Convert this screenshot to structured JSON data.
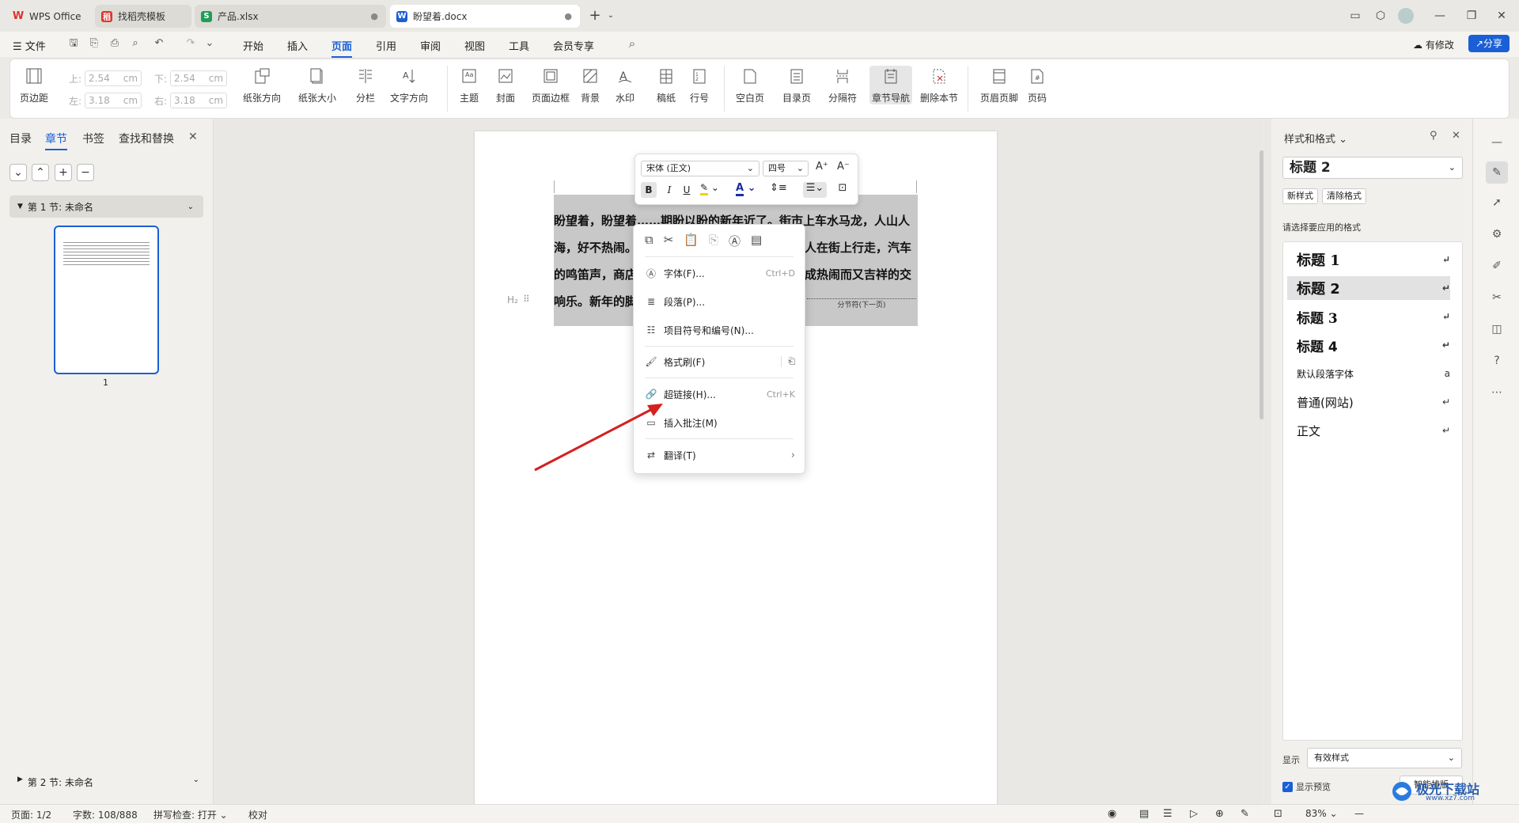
{
  "tabs": [
    {
      "label": "WPS Office",
      "icon": "wps-logo-icon",
      "color": "#e0312b"
    },
    {
      "label": "找稻壳模板",
      "icon": "docer-icon",
      "color": "#e0312b"
    },
    {
      "label": "产品.xlsx",
      "icon": "spreadsheet-icon",
      "color": "#1f9d55"
    },
    {
      "label": "盼望着.docx",
      "icon": "writer-icon",
      "color": "#1a5fd6"
    }
  ],
  "menu": {
    "file": "文件",
    "items": [
      "开始",
      "插入",
      "页面",
      "引用",
      "审阅",
      "视图",
      "工具",
      "会员专享"
    ],
    "active": "页面",
    "revise": "有修改",
    "share": "分享"
  },
  "ribbon": {
    "margins": {
      "top_label": "上:",
      "top_value": "2.54",
      "bottom_label": "下:",
      "bottom_value": "2.54",
      "left_label": "左:",
      "left_value": "3.18",
      "right_label": "右:",
      "right_value": "3.18",
      "unit": "cm"
    },
    "buttons": [
      "页边距",
      "纸张方向",
      "纸张大小",
      "分栏",
      "文字方向",
      "主题",
      "封面",
      "页面边框",
      "背景",
      "水印",
      "稿纸",
      "行号",
      "空白页",
      "目录页",
      "分隔符",
      "章节导航",
      "删除本节",
      "页眉页脚",
      "页码"
    ]
  },
  "left_panel": {
    "tabs": [
      "目录",
      "章节",
      "书签",
      "查找和替换"
    ],
    "active_tab": "章节",
    "section1": "第 1 节: 未命名",
    "section2": "第 2 节: 未命名",
    "page_num": "1"
  },
  "document": {
    "lines": [
      "盼望着，盼望着……期盼以盼的新年近了。街市上车水马龙，人山人",
      "海，好不热闹。",
      "的鸣笛声，商店",
      "响乐。新年的脚"
    ],
    "line2_right": "人在街上行走，汽车",
    "line3_right": "成热闹而又吉祥的交",
    "section_break": "分节符(下一页)",
    "heading_marker": "H₂"
  },
  "mini_toolbar": {
    "font": "宋体 (正文)",
    "size": "四号",
    "bold": "B",
    "italic": "I",
    "underline": "U"
  },
  "context_menu": [
    {
      "label": "字体(F)...",
      "shortcut": "Ctrl+D",
      "icon": "font-icon"
    },
    {
      "label": "段落(P)...",
      "shortcut": "",
      "icon": "paragraph-icon"
    },
    {
      "label": "项目符号和编号(N)...",
      "shortcut": "",
      "icon": "list-icon"
    },
    {
      "label": "格式刷(F)",
      "shortcut": "",
      "icon": "format-painter-icon"
    },
    {
      "label": "超链接(H)...",
      "shortcut": "Ctrl+K",
      "icon": "hyperlink-icon"
    },
    {
      "label": "插入批注(M)",
      "shortcut": "",
      "icon": "comment-icon"
    },
    {
      "label": "翻译(T)",
      "shortcut": "",
      "icon": "translate-icon"
    }
  ],
  "right_panel": {
    "title": "样式和格式",
    "current_style": "标题 2",
    "new_style": "新样式",
    "clear_format": "清除格式",
    "prompt": "请选择要应用的格式",
    "styles": [
      "标题 1",
      "标题 2",
      "标题 3",
      "标题 4",
      "默认段落字体",
      "普通(网站)",
      "正文"
    ],
    "selected_style": "标题 2",
    "show_label": "显示",
    "show_value": "有效样式",
    "preview_label": "显示预览",
    "smart_layout": "智能排版"
  },
  "status": {
    "page": "页面: 1/2",
    "words": "字数: 108/888",
    "spell": "拼写检查: 打开",
    "proof": "校对",
    "zoom": "83%"
  },
  "watermark": "极光下载站",
  "watermark_url": "www.xz7.com",
  "colors": {
    "accent": "#1a5fd6",
    "arrow": "#d42020",
    "selection": "#c8c8c8"
  }
}
